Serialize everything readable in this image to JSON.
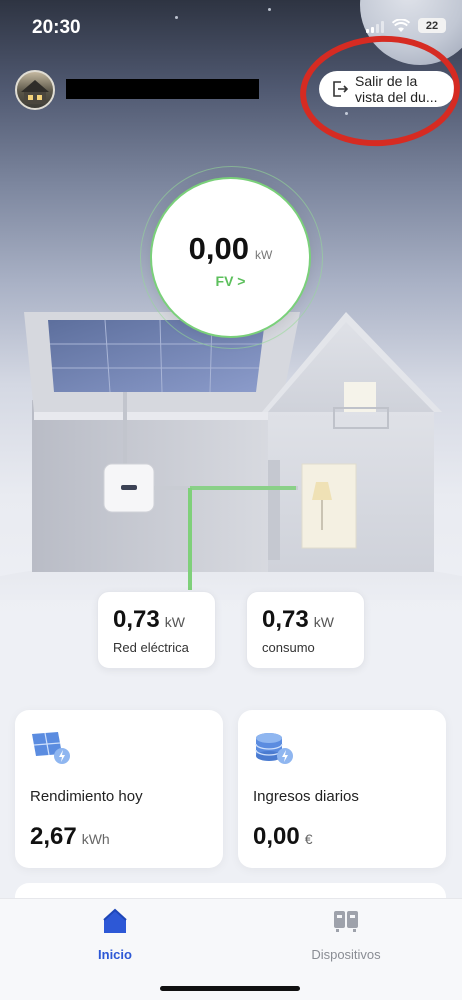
{
  "status_bar": {
    "time": "20:30",
    "battery": "22"
  },
  "header": {
    "exit_button_line1": "Salir de la",
    "exit_button_line2": "vista del du..."
  },
  "pv": {
    "value": "0,00",
    "unit": "kW",
    "link_label": "FV >"
  },
  "flows": [
    {
      "value": "0,73",
      "unit": "kW",
      "label": "Red eléctrica"
    },
    {
      "value": "0,73",
      "unit": "kW",
      "label": "consumo"
    }
  ],
  "summary_cards": [
    {
      "title": "Rendimiento hoy",
      "value": "2,67",
      "unit": "kWh",
      "icon": "solar-panel-icon"
    },
    {
      "title": "Ingresos diarios",
      "value": "0,00",
      "unit": "€",
      "icon": "coins-icon"
    }
  ],
  "tabbar": {
    "home_label": "Inicio",
    "devices_label": "Dispositivos"
  },
  "colors": {
    "accent": "#2d58d6",
    "pv_green": "#5cbf5c",
    "annotation_red": "#d62b22"
  }
}
